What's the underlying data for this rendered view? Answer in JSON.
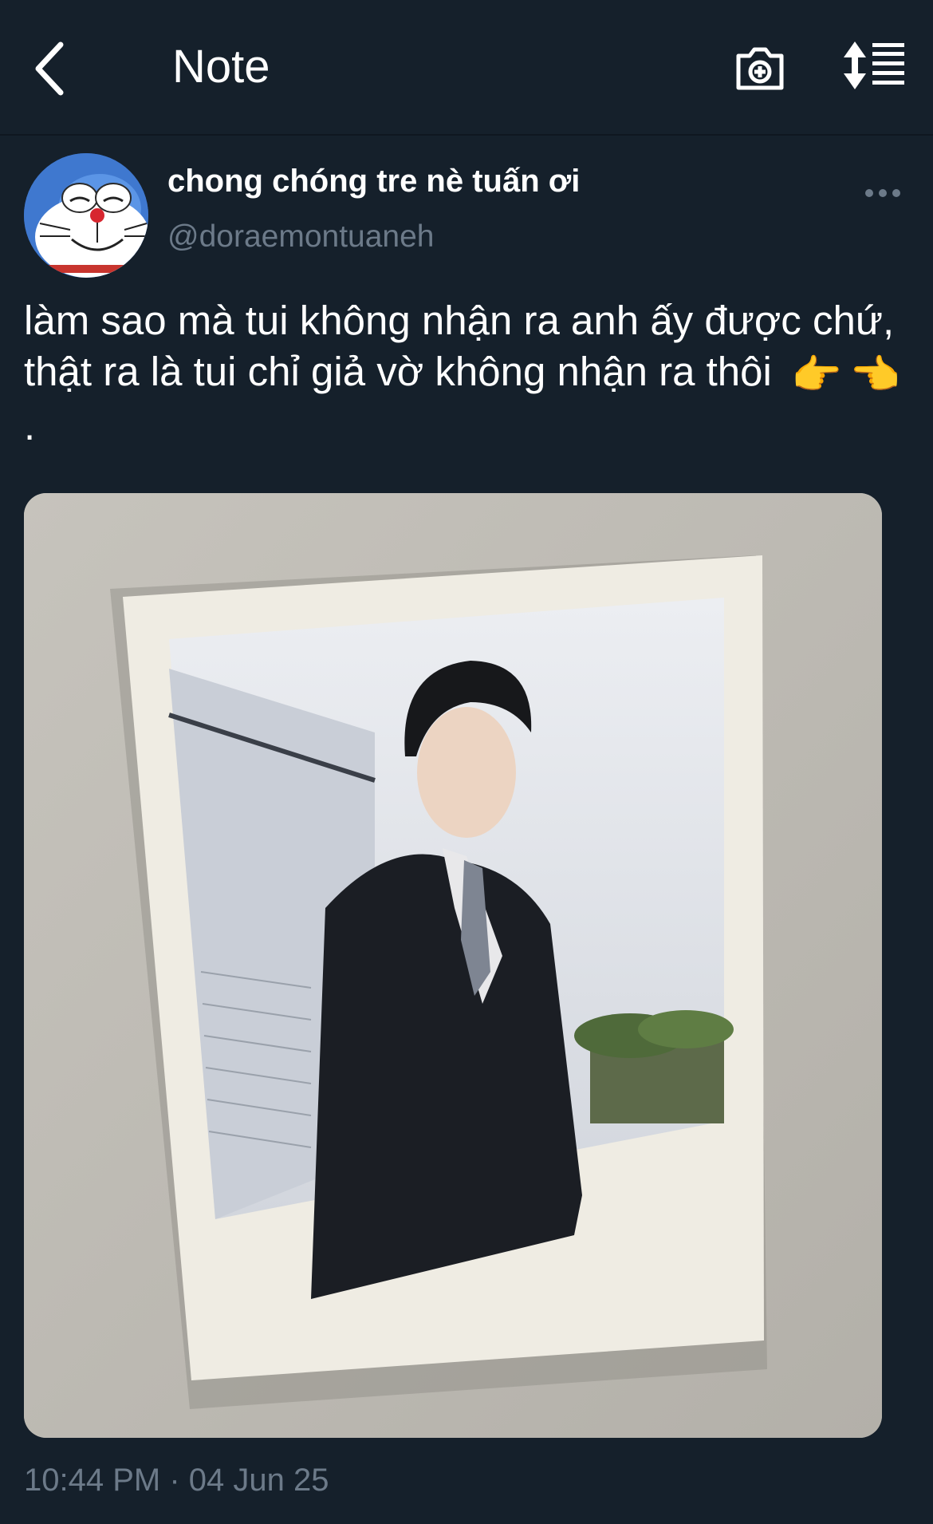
{
  "header": {
    "back_icon": "chevron-left-icon",
    "title": "Note",
    "camera_icon": "camera-add-icon",
    "sort_icon": "sort-list-icon"
  },
  "tweet": {
    "display_name": "chong chóng tre nè tuấn ơi",
    "handle": "@doraemontuaneh",
    "text_main": "làm sao mà tui không nhận ra anh ấy được chứ, thật ra là tui chỉ giả vờ không nhận ra thôi",
    "text_end": ".",
    "emojis": [
      "👉",
      "👈"
    ],
    "timestamp": "10:44 PM · 04 Jun 25",
    "more_icon": "more-dots-icon",
    "avatar_icon": "doraemon-avatar"
  },
  "colors": {
    "background": "#15202b",
    "secondary_text": "#6c7a89",
    "primary_text": "#ffffff"
  }
}
